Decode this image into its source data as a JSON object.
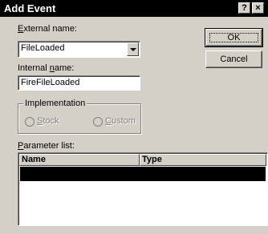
{
  "window": {
    "title": "Add Event",
    "help_glyph": "?",
    "close_glyph": "×"
  },
  "external_name": {
    "label_pre": "",
    "label_accel": "E",
    "label_post": "xternal name:",
    "value": "FileLoaded"
  },
  "internal_name": {
    "label_pre": "Internal ",
    "label_accel": "n",
    "label_post": "ame:",
    "value": "FireFileLoaded"
  },
  "implementation": {
    "title": "Implementation",
    "stock": {
      "accel": "S",
      "rest": "tock"
    },
    "custom": {
      "accel": "C",
      "rest": "ustom"
    }
  },
  "parameters": {
    "label_pre": "",
    "label_accel": "P",
    "label_post": "arameter list:",
    "columns": [
      "Name",
      "Type"
    ]
  },
  "buttons": {
    "ok": "OK",
    "cancel": "Cancel"
  }
}
